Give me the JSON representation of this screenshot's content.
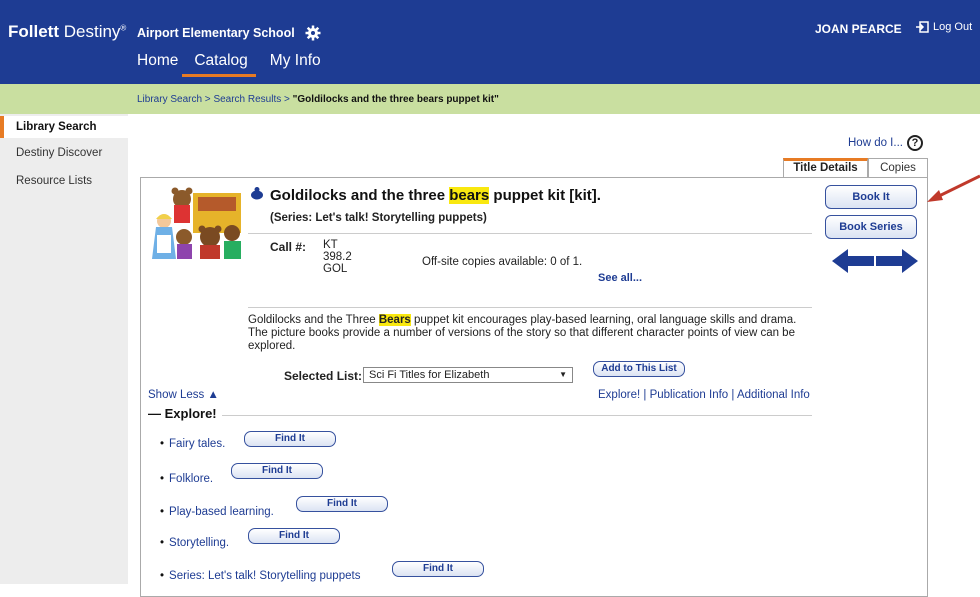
{
  "header": {
    "brand_bold": "Follett",
    "brand_light": "Destiny",
    "brand_mark": "®",
    "school": "Airport Elementary School",
    "user": "JOAN PEARCE",
    "logout": "Log Out",
    "nav": [
      "Home",
      "Catalog",
      "My Info"
    ]
  },
  "breadcrumb": {
    "part1": "Library Search",
    "sep": " > ",
    "part2": "Search Results",
    "current": "\"Goldilocks and the three bears puppet kit\""
  },
  "sidebar": {
    "items": [
      "Library Search",
      "Destiny Discover",
      "Resource Lists"
    ]
  },
  "help": {
    "label": "How do I..."
  },
  "tabs": [
    "Title Details",
    "Copies"
  ],
  "record": {
    "title_pre": "Goldilocks and the three ",
    "title_hl": "bears",
    "title_post": " puppet kit [kit].",
    "series": "(Series: Let's talk! Storytelling puppets)",
    "call_label": "Call #:",
    "call_number": "KT 398.2 GOL",
    "offsite": "Off-site copies available: 0 of 1.",
    "see_all": "See all...",
    "desc_pre": "Goldilocks and the Three ",
    "desc_hl": "Bears",
    "desc_post": " puppet kit encourages play-based learning, oral language skills and drama. The picture books provide a number of versions of the story so that different character points of view can be explored.",
    "selected_list_label": "Selected List:",
    "selected_list_value": "Sci Fi Titles for Elizabeth",
    "add_to_list": "Add to This List",
    "show_less": "Show Less ▲",
    "links": "Explore! | Publication Info | Additional Info"
  },
  "explore": {
    "heading": "Explore!",
    "find_label": "Find It",
    "items": [
      "Fairy tales.",
      "Folklore.",
      "Play-based learning.",
      "Storytelling.",
      "Series: Let's talk! Storytelling puppets"
    ]
  },
  "actions": {
    "book_it": "Book It",
    "book_series": "Book Series"
  },
  "colors": {
    "header_bg": "#1e3c93",
    "breadcrumb_bg": "#c9dfa0",
    "accent": "#e77b24",
    "highlight": "#f9e80f",
    "annotation_arrow": "#c0392b"
  }
}
